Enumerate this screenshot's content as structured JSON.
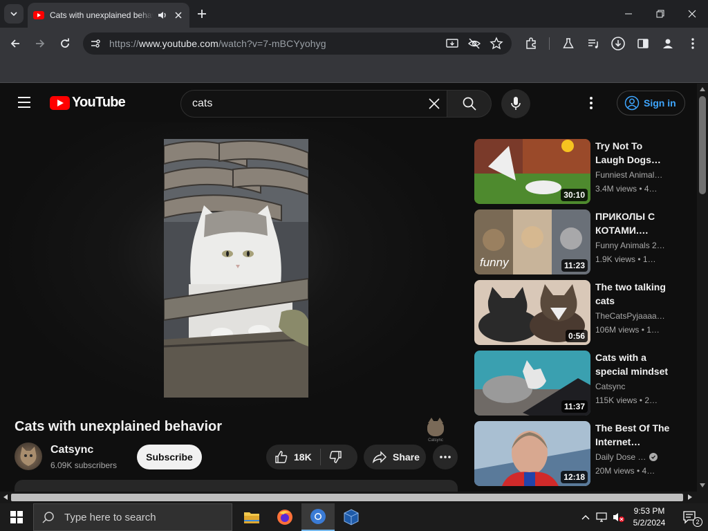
{
  "browser": {
    "tab_title": "Cats with unexplained behavior - YouTube",
    "url_prefix": "https://",
    "url_host": "www.youtube.com",
    "url_path": "/watch?v=7-mBCYyohyg"
  },
  "youtube": {
    "logo_text": "YouTube",
    "search_query": "cats",
    "signin_label": "Sign in"
  },
  "video": {
    "title": "Cats with unexplained behavior",
    "watermark_text": "Catsync",
    "channel_name": "Catsync",
    "subscribers": "6.09K subscribers",
    "subscribe_label": "Subscribe",
    "likes": "18K",
    "share_label": "Share"
  },
  "recommendations": [
    {
      "title": "Try Not To Laugh Dogs…",
      "channel": "Funniest Animal…",
      "meta": "3.4M views  • 4…",
      "duration": "30:10",
      "thumb_color": "#3f7a2b"
    },
    {
      "title": "ПРИКОЛЫ С КОТАМИ.…",
      "channel": "Funny Animals 2…",
      "meta": "1.9K views  • 1…",
      "duration": "11:23",
      "thumb_color": "#8a7a6a"
    },
    {
      "title": "The two talking cats",
      "channel": "TheCatsPyjaaaa…",
      "meta": "106M views  • 1…",
      "duration": "0:56",
      "thumb_color": "#c9b8a8"
    },
    {
      "title": "Cats with a special mindset",
      "channel": "Catsync",
      "meta": "115K views  • 2…",
      "duration": "11:37",
      "thumb_color": "#4aa8b8"
    },
    {
      "title": "The Best Of The Internet…",
      "channel": "Daily Dose …",
      "meta": "20M views  • 4…",
      "duration": "12:18",
      "thumb_color": "#9ab4cc"
    }
  ],
  "taskbar": {
    "search_placeholder": "Type here to search",
    "time": "9:53 PM",
    "date": "5/2/2024",
    "notification_count": "2"
  },
  "colors": {
    "youtube_red": "#ff0000",
    "link_blue": "#3ea6ff",
    "background": "#0f0f0f"
  }
}
